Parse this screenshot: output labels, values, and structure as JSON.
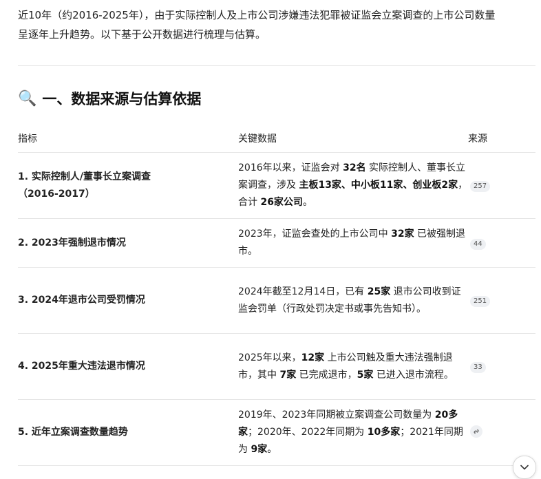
{
  "intro": {
    "line1": "近10年（约2016-2025年），由于实际控制人及上市公司涉嫌违法犯罪被证监会立案调查的上市公司数量",
    "line2": "呈逐年上升趋势。以下基于公开数据进行梳理与估算。"
  },
  "section": {
    "icon": "🔍",
    "title": "一、数据来源与估算依据"
  },
  "table": {
    "headers": [
      "指标",
      "关键数据",
      "来源"
    ],
    "rows": [
      {
        "indicator_l1": "1. 实际控制人/董事长立案调查",
        "indicator_l2": "（2016-2017）",
        "p1": "2016年以来，证监会对 ",
        "b1": "32名",
        "p2": " 实际控制人、董事长立案调查，涉及 ",
        "b2": "主板13家、中小板11家、创业板2家",
        "p3": "，合计 ",
        "b3": "26家公司",
        "p4": "。",
        "source": "257"
      },
      {
        "indicator_l1": "2. 2023年强制退市情况",
        "p1": "2023年，证监会查处的上市公司中 ",
        "b1": "32家",
        "p2": " 已被强制退市。",
        "source": "44"
      },
      {
        "indicator_l1": "3. 2024年退市公司受罚情况",
        "p1": "2024年截至12月14日，已有 ",
        "b1": "25家",
        "p2": " 退市公司收到证监会罚单（行政处罚决定书或事先告知书）。",
        "source": "251"
      },
      {
        "indicator_l1": "4. 2025年重大违法退市情况",
        "p1": "2025年以来，",
        "b1": "12家",
        "p2": " 上市公司触及重大违法强制退市，其中 ",
        "b2": "7家",
        "p3": " 已完成退市，",
        "b3": "5家",
        "p4": " 已进入退市流程。",
        "source": "33"
      },
      {
        "indicator_l1": "5. 近年立案调查数量趋势",
        "p1": "2019年、2023年同期被立案调查公司数量为 ",
        "b1": "20多家",
        "p2": "；2020年、2022年同期为 ",
        "b2": "10多家",
        "p3": "；2021年同期为 ",
        "b3": "9家",
        "p4": "。",
        "source_icon": "link-icon"
      }
    ]
  },
  "scroll_button": {
    "icon": "chevron-down-icon"
  }
}
